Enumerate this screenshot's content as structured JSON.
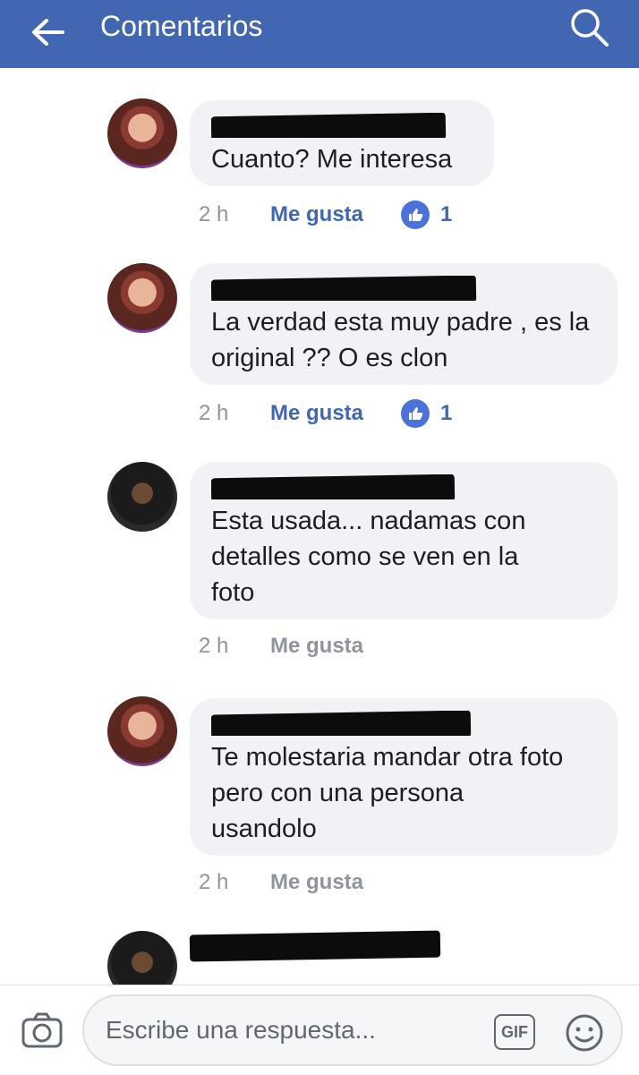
{
  "header": {
    "title": "Comentarios",
    "back_icon": "arrow-left-icon",
    "search_icon": "search-icon",
    "color": "#4267b2"
  },
  "comments": [
    {
      "text": "Cuanto? Me interesa",
      "time": "2 h",
      "like_label": "Me gusta",
      "reaction_count": "1",
      "liked": true
    },
    {
      "text": "La verdad esta muy padre , es la original ?? O es clon",
      "time": "2 h",
      "like_label": "Me gusta",
      "reaction_count": "1",
      "liked": true
    },
    {
      "text": "Esta usada... nadamas con detalles como se ven en la foto",
      "time": "2 h",
      "like_label": "Me gusta",
      "liked": false
    },
    {
      "text": "Te molestaria mandar otra foto pero con una persona usandolo",
      "time": "2 h",
      "like_label": "Me gusta",
      "liked": false
    },
    {
      "text": "",
      "time": "",
      "like_label": ""
    }
  ],
  "composer": {
    "placeholder": "Escribe una respuesta...",
    "gif_label": "GIF",
    "camera_icon": "camera-icon",
    "emoji_icon": "emoji-icon"
  }
}
